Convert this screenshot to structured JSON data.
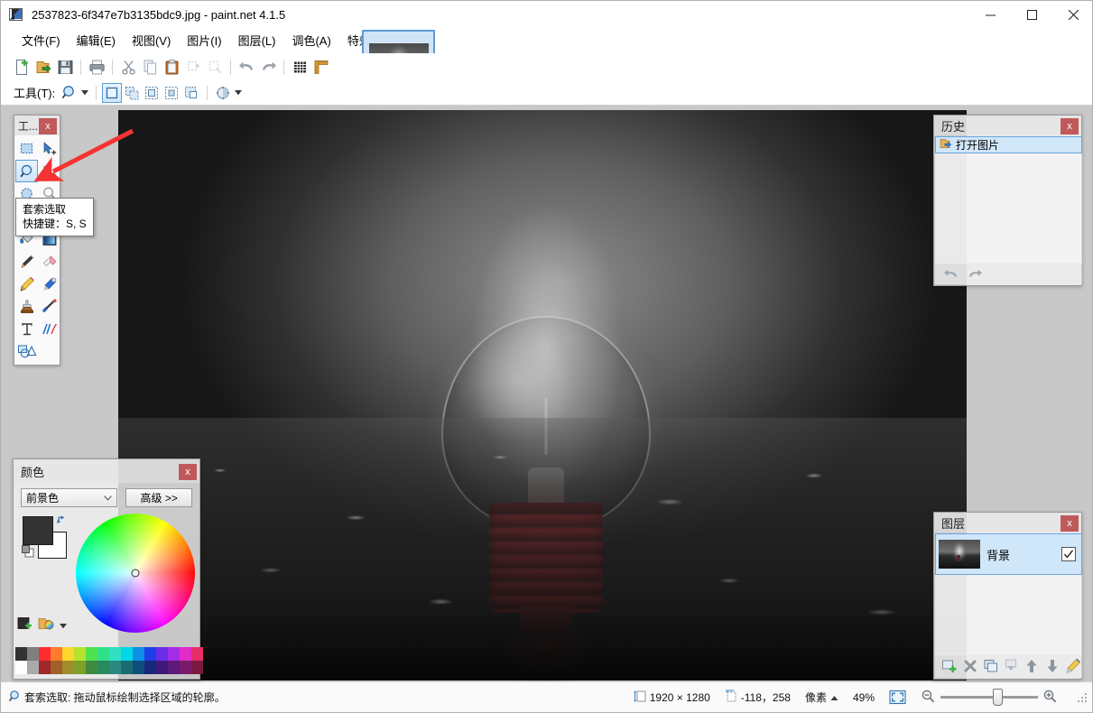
{
  "window": {
    "title": "2537823-6f347e7b3135bdc9.jpg - paint.net 4.1.5",
    "app_icon": "paintnet-icon",
    "minimize_label": "–",
    "maximize_label": "☐",
    "close_label": "✕"
  },
  "menu": {
    "items": [
      {
        "label": "文件(F)",
        "name": "menu-file"
      },
      {
        "label": "编辑(E)",
        "name": "menu-edit"
      },
      {
        "label": "视图(V)",
        "name": "menu-view"
      },
      {
        "label": "图片(I)",
        "name": "menu-image"
      },
      {
        "label": "图层(L)",
        "name": "menu-layers"
      },
      {
        "label": "调色(A)",
        "name": "menu-adjustments"
      },
      {
        "label": "特效(C)",
        "name": "menu-effects"
      }
    ]
  },
  "thumbnail_strip": {
    "active_thumb_name": "image-thumbnail",
    "dropdown_name": "thumbnail-list-dropdown"
  },
  "right_toolbar": {
    "buttons": [
      {
        "name": "tools-window-toggle",
        "icon": "hammer-icon",
        "active": true
      },
      {
        "name": "history-window-toggle",
        "icon": "clock-icon",
        "active": true
      },
      {
        "name": "layers-window-toggle",
        "icon": "layers-icon",
        "active": true
      },
      {
        "name": "colors-window-toggle",
        "icon": "color-wheel-icon",
        "active": true
      },
      {
        "name": "settings-button",
        "icon": "gear-icon",
        "active": false
      },
      {
        "name": "help-button",
        "icon": "question-icon",
        "active": false
      }
    ]
  },
  "toolbar": {
    "buttons": [
      {
        "name": "new-button",
        "icon": "new-document-icon"
      },
      {
        "name": "open-button",
        "icon": "open-folder-icon"
      },
      {
        "name": "save-button",
        "icon": "floppy-disk-icon"
      },
      {
        "name": "print-button",
        "icon": "printer-icon"
      },
      {
        "name": "cut-button",
        "icon": "scissors-icon"
      },
      {
        "name": "copy-button",
        "icon": "copy-icon"
      },
      {
        "name": "paste-button",
        "icon": "clipboard-icon"
      },
      {
        "name": "crop-to-selection-button",
        "icon": "crop-icon"
      },
      {
        "name": "deselect-all-button",
        "icon": "deselect-icon"
      },
      {
        "name": "undo-button",
        "icon": "undo-arrow-icon"
      },
      {
        "name": "redo-button",
        "icon": "redo-arrow-icon"
      },
      {
        "name": "pixel-grid-button",
        "icon": "grid-icon"
      },
      {
        "name": "rulers-button",
        "icon": "ruler-icon"
      }
    ]
  },
  "tool_options": {
    "label": "工具(T):",
    "current_tool_icon": "magnifier-lasso-icon",
    "selection_modes": [
      {
        "name": "selection-mode-replace",
        "icon": "replace-selection-icon",
        "active": true
      },
      {
        "name": "selection-mode-union",
        "icon": "union-selection-icon",
        "active": false
      },
      {
        "name": "selection-mode-exclude",
        "icon": "exclude-selection-icon",
        "active": false
      },
      {
        "name": "selection-mode-intersect",
        "icon": "intersect-selection-icon",
        "active": false
      },
      {
        "name": "selection-mode-xor",
        "icon": "xor-selection-icon",
        "active": false
      }
    ],
    "antialias_icon": "antialiasing-icon"
  },
  "tools_panel": {
    "title": "工...",
    "close_label": "x",
    "tools": [
      {
        "name": "tool-rectangle-select",
        "icon": "rectangle-select-icon",
        "active": false
      },
      {
        "name": "tool-move-selected",
        "icon": "move-selected-icon",
        "active": false
      },
      {
        "name": "tool-lasso-select",
        "icon": "lasso-select-icon",
        "active": true
      },
      {
        "name": "tool-move-selection",
        "icon": "move-selection-icon",
        "active": false
      },
      {
        "name": "tool-ellipse-select",
        "icon": "ellipse-select-icon",
        "active": false
      },
      {
        "name": "tool-zoom",
        "icon": "zoom-magnifier-icon",
        "active": false
      },
      {
        "name": "tool-magic-wand",
        "icon": "magic-wand-icon",
        "active": false
      },
      {
        "name": "tool-pan",
        "icon": "pan-hand-icon",
        "active": false
      },
      {
        "name": "tool-paint-bucket",
        "icon": "paint-bucket-icon",
        "active": false
      },
      {
        "name": "tool-gradient",
        "icon": "gradient-icon",
        "active": false
      },
      {
        "name": "tool-paintbrush",
        "icon": "paintbrush-icon",
        "active": false
      },
      {
        "name": "tool-eraser",
        "icon": "eraser-icon",
        "active": false
      },
      {
        "name": "tool-pencil",
        "icon": "pencil-icon",
        "active": false
      },
      {
        "name": "tool-color-picker",
        "icon": "eyedropper-icon",
        "active": false
      },
      {
        "name": "tool-clone-stamp",
        "icon": "clone-stamp-icon",
        "active": false
      },
      {
        "name": "tool-recolor",
        "icon": "recolor-icon",
        "active": false
      },
      {
        "name": "tool-text",
        "icon": "text-icon",
        "active": false
      },
      {
        "name": "tool-line-curve",
        "icon": "line-curve-icon",
        "active": false
      },
      {
        "name": "tool-shapes",
        "icon": "shapes-icon",
        "active": false
      }
    ]
  },
  "tooltip": {
    "title": "套索选取",
    "shortcut": "快捷键：S, S"
  },
  "colors_panel": {
    "title": "颜色",
    "close_label": "x",
    "mode_value": "前景色",
    "advanced_label": "高级 >>",
    "foreground_color": "#333333",
    "background_color": "#ffffff",
    "swap_icon": "swap-colors-icon",
    "reset_icon": "reset-colors-icon",
    "add_color_icon": "add-to-palette-icon",
    "open_palette_icon": "open-palette-icon",
    "palette_caret_icon": "chevron-down-icon",
    "palette_row1": [
      "#333333",
      "#7f7f7f",
      "#ff2d2d",
      "#ff7a2d",
      "#ffd62d",
      "#b6e32d",
      "#4fe04f",
      "#2fe089",
      "#2fe0c4",
      "#00d8e8",
      "#0d8fe8",
      "#1e3ee8",
      "#6a2de8",
      "#a52de8",
      "#e02dc8",
      "#e82d6a"
    ],
    "palette_row2": [
      "#ffffff",
      "#a9a9a9",
      "#a02828",
      "#a0602a",
      "#a08c2a",
      "#7fa02a",
      "#3f8a3f",
      "#2a8a5f",
      "#2a8a80",
      "#1a6b74",
      "#0d4f7a",
      "#17287a",
      "#3f1a7a",
      "#5c1a7a",
      "#7a1a6a",
      "#7a1a42"
    ],
    "wheel_cursor_name": "color-wheel-cursor"
  },
  "history_panel": {
    "title": "历史",
    "close_label": "x",
    "items": [
      {
        "label": "打开图片",
        "icon": "open-image-icon",
        "selected": true
      }
    ],
    "undo_icon": "undo-arrow-icon",
    "redo_icon": "redo-arrow-icon"
  },
  "layers_panel": {
    "title": "图层",
    "close_label": "x",
    "layers": [
      {
        "name": "背景",
        "visible": true,
        "selected": true
      }
    ],
    "footer_buttons": [
      {
        "name": "add-layer-button",
        "icon": "add-layer-icon"
      },
      {
        "name": "delete-layer-button",
        "icon": "delete-layer-icon"
      },
      {
        "name": "duplicate-layer-button",
        "icon": "duplicate-layer-icon"
      },
      {
        "name": "merge-layer-down-button",
        "icon": "merge-down-icon"
      },
      {
        "name": "move-layer-up-button",
        "icon": "arrow-up-icon"
      },
      {
        "name": "move-layer-down-button",
        "icon": "arrow-down-icon"
      },
      {
        "name": "layer-properties-button",
        "icon": "layer-properties-icon"
      }
    ]
  },
  "statusbar": {
    "tool_icon": "magnifier-icon",
    "text": "套索选取: 拖动鼠标绘制选择区域的轮廓。",
    "image_size_icon": "image-size-icon",
    "image_size": "1920 × 1280",
    "cursor_icon": "cursor-position-icon",
    "cursor_position": "-118，258",
    "units_label": "像素",
    "units_caret": "▲",
    "zoom_level": "49%",
    "fit_icon": "fit-to-window-icon",
    "zoom_out_icon": "zoom-out-icon",
    "zoom_in_icon": "zoom-in-icon",
    "grip_icon": "resize-grip-icon"
  },
  "canvas": {
    "image_name": "lightbulb-photo",
    "annotation_arrow_name": "red-pointer-arrow",
    "annotation_color": "#f63333"
  }
}
